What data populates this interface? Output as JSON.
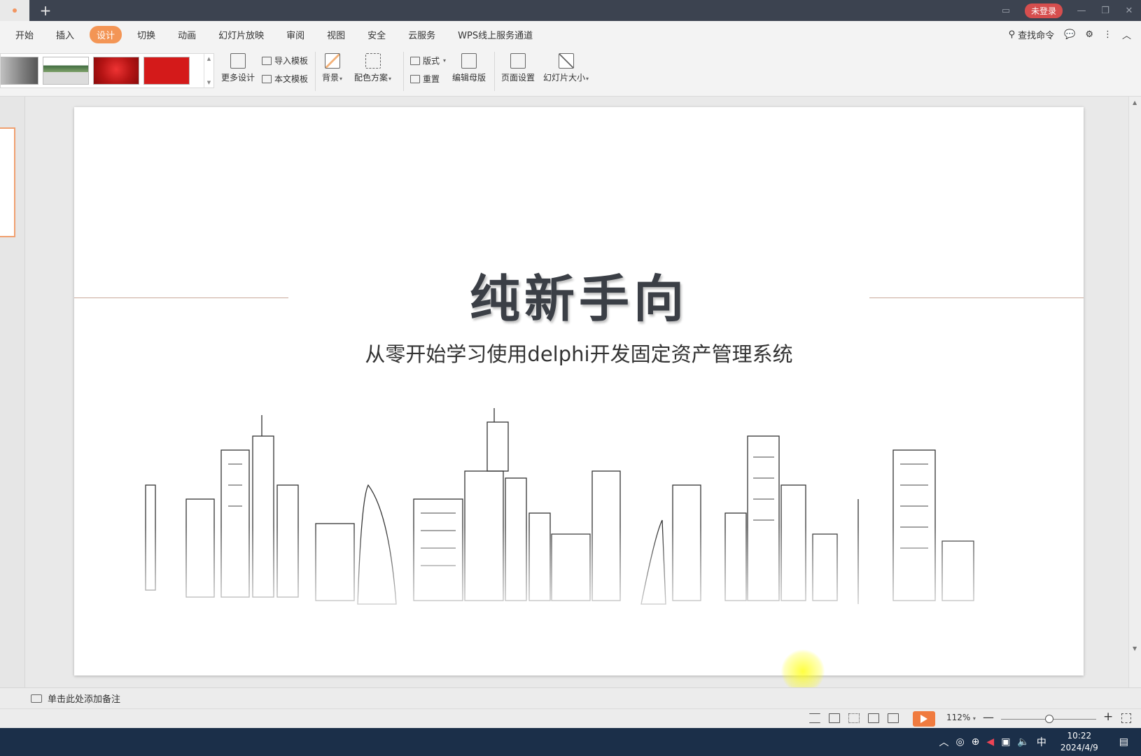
{
  "window": {
    "login_label": "未登录"
  },
  "menu": {
    "items": [
      {
        "label": "开始"
      },
      {
        "label": "插入"
      },
      {
        "label": "设计",
        "active": true
      },
      {
        "label": "切换"
      },
      {
        "label": "动画"
      },
      {
        "label": "幻灯片放映"
      },
      {
        "label": "审阅"
      },
      {
        "label": "视图"
      },
      {
        "label": "安全"
      },
      {
        "label": "云服务"
      },
      {
        "label": "WPS线上服务通道"
      }
    ],
    "search_label": "查找命令"
  },
  "ribbon": {
    "more_design": "更多设计",
    "import_template": "导入模板",
    "this_template": "本文模板",
    "background": "背景",
    "color_scheme": "配色方案",
    "layout": "版式",
    "reset": "重置",
    "edit_master": "编辑母版",
    "page_setup": "页面设置",
    "slide_size": "幻灯片大小"
  },
  "slide": {
    "title": "纯新手向",
    "subtitle": "从零开始学习使用delphi开发固定资产管理系统"
  },
  "notes": {
    "placeholder": "单击此处添加备注"
  },
  "status": {
    "zoom": "112%"
  },
  "taskbar": {
    "time": "10:22",
    "date": "2024/4/9",
    "ime": "中"
  },
  "colors": {
    "accent": "#f39555",
    "titlebar": "#3c4350",
    "taskbar": "#1b2f49",
    "play": "#f07b3f"
  }
}
